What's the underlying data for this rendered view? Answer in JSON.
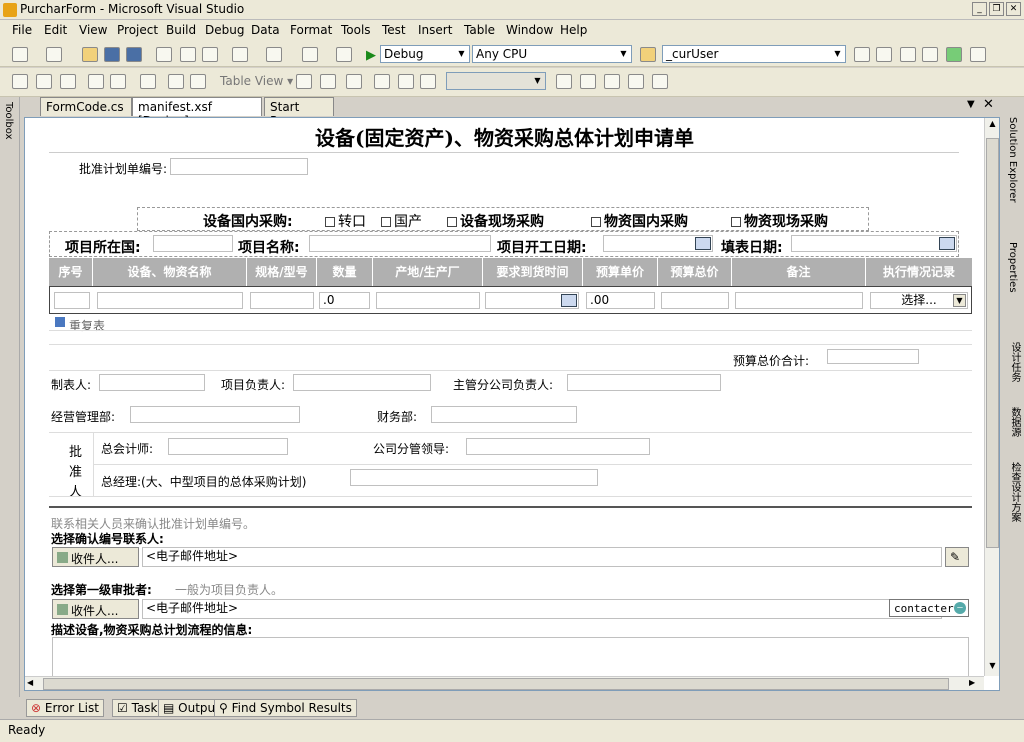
{
  "window": {
    "title": "PurcharForm - Microsoft Visual Studio"
  },
  "menu": [
    "File",
    "Edit",
    "View",
    "Project",
    "Build",
    "Debug",
    "Data",
    "Format",
    "Tools",
    "Test",
    "Insert",
    "Table",
    "Window",
    "Help"
  ],
  "toolbar": {
    "config": "Debug",
    "platform": "Any CPU",
    "find_value": "_curUser",
    "table_view": "Table View"
  },
  "side": {
    "toolbox": "Toolbox",
    "solution_explorer": "Solution Explorer",
    "properties": "Properties",
    "design_tasks": "设计任务",
    "data_source": "数据源",
    "check_design": "检查设计方案"
  },
  "tabs": [
    "FormCode.cs",
    "manifest.xsf [Design]",
    "Start Page"
  ],
  "form": {
    "title": "设备(固定资产)、物资采购总体计划申请单",
    "approval_no_label": "批准计划单编号:",
    "purchase_type_label": "设备国内采购:",
    "purchase_options": [
      "转口",
      "国产",
      "设备现场采购",
      "物资国内采购",
      "物资现场采购"
    ],
    "country_label": "项目所在国:",
    "project_name_label": "项目名称:",
    "start_date_label": "项目开工日期:",
    "fill_date_label": "填表日期:",
    "columns": [
      "序号",
      "设备、物资名称",
      "规格/型号",
      "数量",
      "产地/生产厂",
      "要求到货时间",
      "预算单价",
      "预算总价",
      "备注",
      "执行情况记录"
    ],
    "qty_default": ".0",
    "price_default": ".00",
    "status_select": "选择...",
    "repeat_table": "重复表",
    "budget_total_label": "预算总价合计:",
    "preparer_label": "制表人:",
    "pm_label": "项目负责人:",
    "branch_head_label": "主管分公司负责人:",
    "ops_label": "经营管理部:",
    "finance_label": "财务部:",
    "approver_label": "批准人",
    "chief_accountant_label": "总会计师:",
    "vp_label": "公司分管领导:",
    "gm_label": "总经理:(大、中型项目的总体采购计划)",
    "contact_hint": "联系相关人员来确认批准计划单编号。",
    "confirm_contact_label": "选择确认编号联系人:",
    "recipient_btn": "收件人...",
    "email_placeholder": "<电子邮件地址>",
    "first_approver_label": "选择第一级审批者:",
    "first_approver_hint": "一般为项目负责人。",
    "contacter": "contacter",
    "describe_label": "描述设备,物资采购总计划流程的信息:"
  },
  "bottom_tabs": [
    "Error List",
    "Task List",
    "Output",
    "Find Symbol Results"
  ],
  "status": "Ready"
}
